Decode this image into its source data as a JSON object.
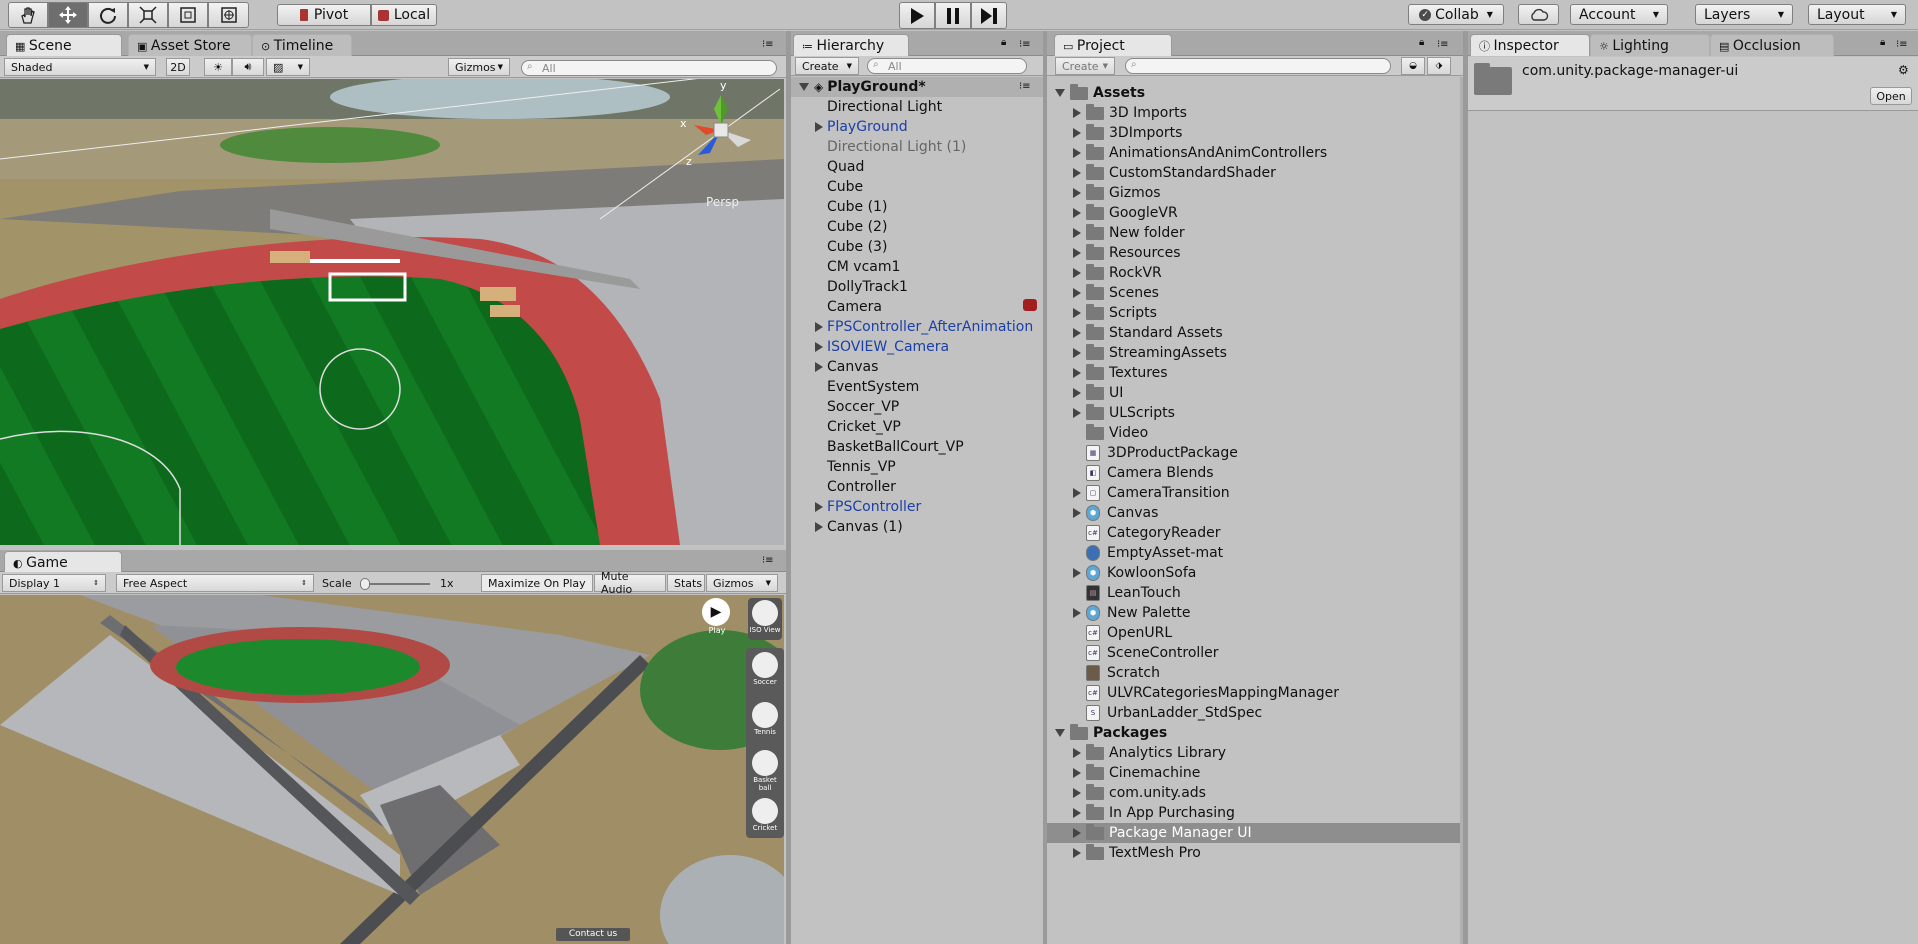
{
  "toolbar": {
    "pivot": "Pivot",
    "local": "Local",
    "collab": "Collab",
    "account": "Account",
    "layers": "Layers",
    "layout": "Layout"
  },
  "scene": {
    "tabs": [
      "Scene",
      "Asset Store",
      "Timeline"
    ],
    "shading": "Shaded",
    "mode2d": "2D",
    "gizmos": "Gizmos",
    "search_placeholder": "All",
    "gizmo_axes": [
      "y",
      "x",
      "z"
    ],
    "persp": "Persp"
  },
  "game": {
    "tab": "Game",
    "display": "Display 1",
    "aspect": "Free Aspect",
    "scale_label": "Scale",
    "scale_value": "1x",
    "maximize": "Maximize On Play",
    "mute": "Mute Audio",
    "stats": "Stats",
    "gizmos": "Gizmos",
    "overlay_buttons": [
      "Play",
      "ISO View",
      "Soccer",
      "Tennis",
      "Basket ball",
      "Cricket"
    ],
    "contact": "Contact us"
  },
  "hierarchy": {
    "tab": "Hierarchy",
    "create": "Create",
    "search_placeholder": "All",
    "scene_name": "PlayGround*",
    "items": [
      {
        "label": "Directional Light",
        "expand": false,
        "style": ""
      },
      {
        "label": "PlayGround",
        "expand": true,
        "style": "blue"
      },
      {
        "label": "Directional Light (1)",
        "expand": false,
        "style": "gray"
      },
      {
        "label": "Quad",
        "expand": false,
        "style": ""
      },
      {
        "label": "Cube",
        "expand": false,
        "style": ""
      },
      {
        "label": "Cube (1)",
        "expand": false,
        "style": ""
      },
      {
        "label": "Cube (2)",
        "expand": false,
        "style": ""
      },
      {
        "label": "Cube (3)",
        "expand": false,
        "style": ""
      },
      {
        "label": "CM vcam1",
        "expand": false,
        "style": ""
      },
      {
        "label": "DollyTrack1",
        "expand": false,
        "style": ""
      },
      {
        "label": "Camera",
        "expand": false,
        "style": ""
      },
      {
        "label": "FPSController_AfterAnimation",
        "expand": true,
        "style": "blue"
      },
      {
        "label": "ISOVIEW_Camera",
        "expand": true,
        "style": "blue"
      },
      {
        "label": "Canvas",
        "expand": true,
        "style": ""
      },
      {
        "label": "EventSystem",
        "expand": false,
        "style": ""
      },
      {
        "label": "Soccer_VP",
        "expand": false,
        "style": ""
      },
      {
        "label": "Cricket_VP",
        "expand": false,
        "style": ""
      },
      {
        "label": "BasketBallCourt_VP",
        "expand": false,
        "style": ""
      },
      {
        "label": "Tennis_VP",
        "expand": false,
        "style": ""
      },
      {
        "label": "Controller",
        "expand": false,
        "style": ""
      },
      {
        "label": "FPSController",
        "expand": true,
        "style": "blue"
      },
      {
        "label": "Canvas (1)",
        "expand": true,
        "style": ""
      }
    ]
  },
  "project": {
    "tab": "Project",
    "create": "Create",
    "assets_root": "Assets",
    "assets": [
      {
        "label": "3D Imports",
        "kind": "folder",
        "expand": true
      },
      {
        "label": "3DImports",
        "kind": "folder",
        "expand": true
      },
      {
        "label": "AnimationsAndAnimControllers",
        "kind": "folder",
        "expand": true
      },
      {
        "label": "CustomStandardShader",
        "kind": "folder",
        "expand": true
      },
      {
        "label": "Gizmos",
        "kind": "folder",
        "expand": true
      },
      {
        "label": "GoogleVR",
        "kind": "folder",
        "expand": true
      },
      {
        "label": "New folder",
        "kind": "folder",
        "expand": true
      },
      {
        "label": "Resources",
        "kind": "folder",
        "expand": true
      },
      {
        "label": "RockVR",
        "kind": "folder",
        "expand": true
      },
      {
        "label": "Scenes",
        "kind": "folder",
        "expand": true
      },
      {
        "label": "Scripts",
        "kind": "folder",
        "expand": true
      },
      {
        "label": "Standard Assets",
        "kind": "folder",
        "expand": true
      },
      {
        "label": "StreamingAssets",
        "kind": "folder",
        "expand": true
      },
      {
        "label": "Textures",
        "kind": "folder",
        "expand": true
      },
      {
        "label": "UI",
        "kind": "folder",
        "expand": true
      },
      {
        "label": "ULScripts",
        "kind": "folder",
        "expand": true
      },
      {
        "label": "Video",
        "kind": "folder",
        "expand": false
      },
      {
        "label": "3DProductPackage",
        "kind": "package",
        "expand": false
      },
      {
        "label": "Camera Blends",
        "kind": "asset",
        "expand": false
      },
      {
        "label": "CameraTransition",
        "kind": "anim",
        "expand": true
      },
      {
        "label": "Canvas",
        "kind": "prefab",
        "expand": true
      },
      {
        "label": "CategoryReader",
        "kind": "script",
        "expand": false
      },
      {
        "label": "EmptyAsset-mat",
        "kind": "material",
        "expand": false
      },
      {
        "label": "KowloonSofa",
        "kind": "prefab",
        "expand": true
      },
      {
        "label": "LeanTouch",
        "kind": "texture",
        "expand": false
      },
      {
        "label": "New Palette",
        "kind": "prefab",
        "expand": true
      },
      {
        "label": "OpenURL",
        "kind": "script",
        "expand": false
      },
      {
        "label": "SceneController",
        "kind": "script",
        "expand": false
      },
      {
        "label": "Scratch",
        "kind": "image",
        "expand": false
      },
      {
        "label": "ULVRCategoriesMappingManager",
        "kind": "script",
        "expand": false
      },
      {
        "label": "UrbanLadder_StdSpec",
        "kind": "shader",
        "expand": false
      }
    ],
    "packages_root": "Packages",
    "packages": [
      {
        "label": "Analytics Library",
        "selected": false
      },
      {
        "label": "Cinemachine",
        "selected": false
      },
      {
        "label": "com.unity.ads",
        "selected": false
      },
      {
        "label": "In App Purchasing",
        "selected": false
      },
      {
        "label": "Package Manager UI",
        "selected": true
      },
      {
        "label": "TextMesh Pro",
        "selected": false
      }
    ]
  },
  "inspector": {
    "tabs": [
      "Inspector",
      "Lighting",
      "Occlusion"
    ],
    "object_name": "com.unity.package-manager-ui",
    "open": "Open"
  }
}
